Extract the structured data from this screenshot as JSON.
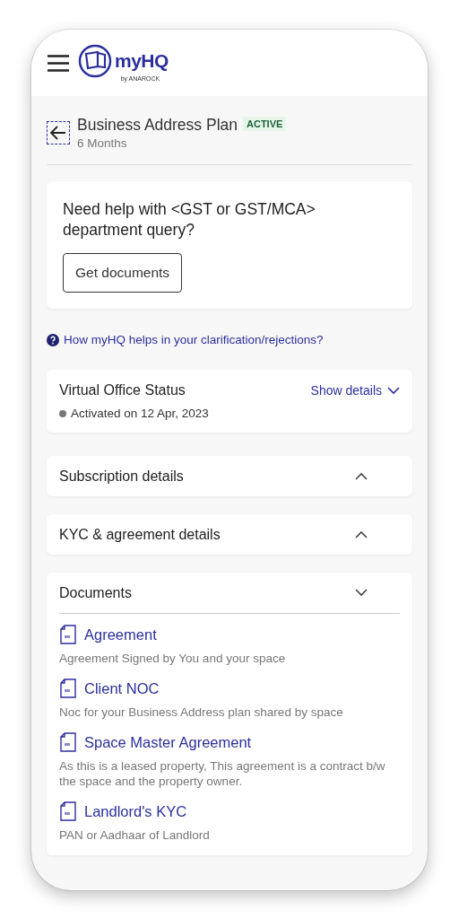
{
  "header": {
    "logo_name": "myHQ",
    "logo_tagline": "by ANAROCK"
  },
  "plan": {
    "title": "Business Address Plan",
    "badge": "ACTIVE",
    "duration": "6 Months"
  },
  "help_card": {
    "question": "Need help with <GST or GST/MCA> department query?",
    "button": "Get documents"
  },
  "help_link": "How myHQ helps in your clarification/rejections?",
  "status_card": {
    "title": "Virtual Office Status",
    "action": "Show details",
    "status": "Activated on 12 Apr, 2023"
  },
  "sections": [
    {
      "title": "Subscription details",
      "expanded": false
    },
    {
      "title": "KYC & agreement details",
      "expanded": false
    },
    {
      "title": "Documents",
      "expanded": true,
      "documents": [
        {
          "name": "Agreement",
          "description": "Agreement Signed by You and your space"
        },
        {
          "name": "Client NOC",
          "description": "Noc for your Business Address plan shared by space"
        },
        {
          "name": "Space Master Agreement",
          "description": "As this is a leased property, This agreement is a contract b/w the space and the property owner."
        },
        {
          "name": "Landlord's KYC",
          "description": "PAN or Aadhaar of Landlord"
        }
      ]
    }
  ]
}
